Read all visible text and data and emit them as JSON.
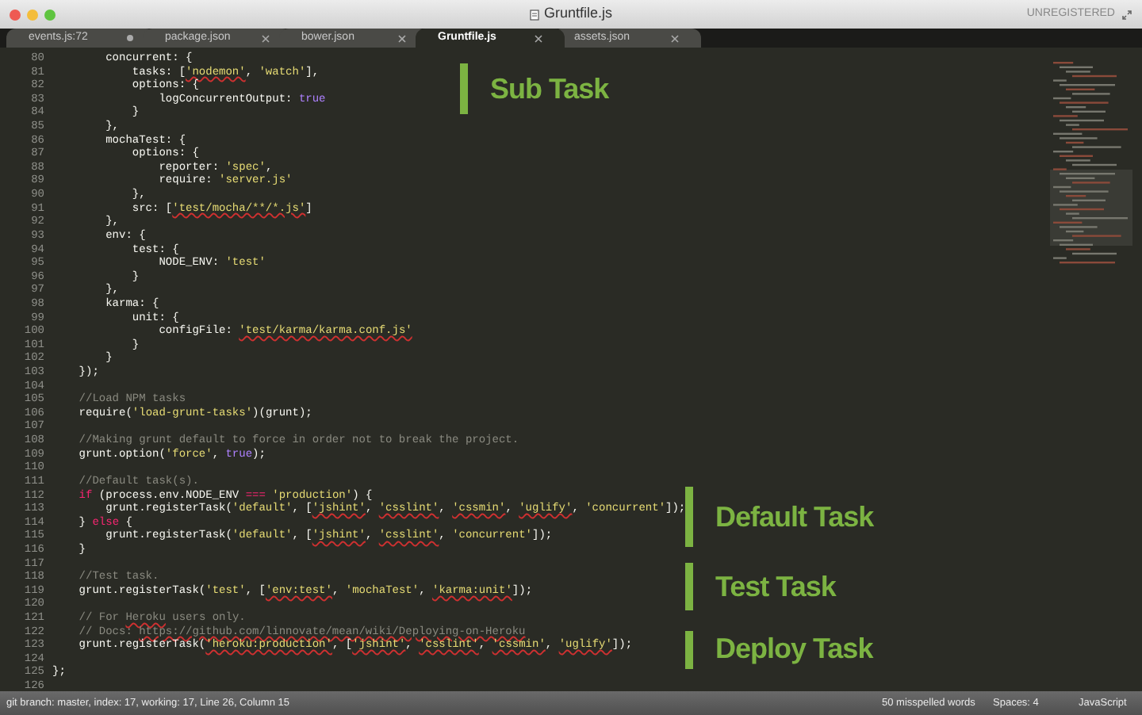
{
  "window": {
    "title": "Gruntfile.js",
    "registration": "UNREGISTERED"
  },
  "tabs": [
    {
      "label": "events.js:72",
      "selected": false,
      "modified": true
    },
    {
      "label": "package.json",
      "selected": false,
      "modified": false
    },
    {
      "label": "bower.json",
      "selected": false,
      "modified": false
    },
    {
      "label": "Gruntfile.js",
      "selected": true,
      "modified": false
    },
    {
      "label": "assets.json",
      "selected": false,
      "modified": false
    }
  ],
  "code": [
    {
      "number": "80",
      "segments": [
        {
          "text": "        concurrent: {",
          "kind": "plain",
          "misspelled": false
        }
      ]
    },
    {
      "number": "81",
      "segments": [
        {
          "text": "            tasks: [",
          "kind": "plain",
          "misspelled": false
        },
        {
          "text": "'nodemon'",
          "kind": "string",
          "misspelled": true
        },
        {
          "text": ", ",
          "kind": "plain",
          "misspelled": false
        },
        {
          "text": "'watch'",
          "kind": "string",
          "misspelled": false
        },
        {
          "text": "],",
          "kind": "plain",
          "misspelled": false
        }
      ]
    },
    {
      "number": "82",
      "segments": [
        {
          "text": "            options: {",
          "kind": "plain",
          "misspelled": false
        }
      ]
    },
    {
      "number": "83",
      "segments": [
        {
          "text": "                logConcurrentOutput: ",
          "kind": "plain",
          "misspelled": false
        },
        {
          "text": "true",
          "kind": "constant",
          "misspelled": false
        }
      ]
    },
    {
      "number": "84",
      "segments": [
        {
          "text": "            }",
          "kind": "plain",
          "misspelled": false
        }
      ]
    },
    {
      "number": "85",
      "segments": [
        {
          "text": "        },",
          "kind": "plain",
          "misspelled": false
        }
      ]
    },
    {
      "number": "86",
      "segments": [
        {
          "text": "        mochaTest: {",
          "kind": "plain",
          "misspelled": false
        }
      ]
    },
    {
      "number": "87",
      "segments": [
        {
          "text": "            options: {",
          "kind": "plain",
          "misspelled": false
        }
      ]
    },
    {
      "number": "88",
      "segments": [
        {
          "text": "                reporter: ",
          "kind": "plain",
          "misspelled": false
        },
        {
          "text": "'spec'",
          "kind": "string",
          "misspelled": false
        },
        {
          "text": ",",
          "kind": "plain",
          "misspelled": false
        }
      ]
    },
    {
      "number": "89",
      "segments": [
        {
          "text": "                require: ",
          "kind": "plain",
          "misspelled": false
        },
        {
          "text": "'server.js'",
          "kind": "string",
          "misspelled": false
        }
      ]
    },
    {
      "number": "90",
      "segments": [
        {
          "text": "            },",
          "kind": "plain",
          "misspelled": false
        }
      ]
    },
    {
      "number": "91",
      "segments": [
        {
          "text": "            src: [",
          "kind": "plain",
          "misspelled": false
        },
        {
          "text": "'test/mocha/**/*.js'",
          "kind": "string",
          "misspelled": true
        },
        {
          "text": "]",
          "kind": "plain",
          "misspelled": false
        }
      ]
    },
    {
      "number": "92",
      "segments": [
        {
          "text": "        },",
          "kind": "plain",
          "misspelled": false
        }
      ]
    },
    {
      "number": "93",
      "segments": [
        {
          "text": "        env: {",
          "kind": "plain",
          "misspelled": false
        }
      ]
    },
    {
      "number": "94",
      "segments": [
        {
          "text": "            test: {",
          "kind": "plain",
          "misspelled": false
        }
      ]
    },
    {
      "number": "95",
      "segments": [
        {
          "text": "                NODE_ENV: ",
          "kind": "plain",
          "misspelled": false
        },
        {
          "text": "'test'",
          "kind": "string",
          "misspelled": false
        }
      ]
    },
    {
      "number": "96",
      "segments": [
        {
          "text": "            }",
          "kind": "plain",
          "misspelled": false
        }
      ]
    },
    {
      "number": "97",
      "segments": [
        {
          "text": "        },",
          "kind": "plain",
          "misspelled": false
        }
      ]
    },
    {
      "number": "98",
      "segments": [
        {
          "text": "        karma: {",
          "kind": "plain",
          "misspelled": false
        }
      ]
    },
    {
      "number": "99",
      "segments": [
        {
          "text": "            unit: {",
          "kind": "plain",
          "misspelled": false
        }
      ]
    },
    {
      "number": "100",
      "segments": [
        {
          "text": "                configFile: ",
          "kind": "plain",
          "misspelled": false
        },
        {
          "text": "'test/karma/karma.conf.js'",
          "kind": "string",
          "misspelled": true
        }
      ]
    },
    {
      "number": "101",
      "segments": [
        {
          "text": "            }",
          "kind": "plain",
          "misspelled": false
        }
      ]
    },
    {
      "number": "102",
      "segments": [
        {
          "text": "        }",
          "kind": "plain",
          "misspelled": false
        }
      ]
    },
    {
      "number": "103",
      "segments": [
        {
          "text": "    });",
          "kind": "plain",
          "misspelled": false
        }
      ]
    },
    {
      "number": "104"
    },
    {
      "number": "105",
      "segments": [
        {
          "text": "    //Load NPM tasks",
          "kind": "comment",
          "misspelled": false
        }
      ]
    },
    {
      "number": "106",
      "segments": [
        {
          "text": "    require(",
          "kind": "plain",
          "misspelled": false
        },
        {
          "text": "'load-grunt-tasks'",
          "kind": "string",
          "misspelled": false
        },
        {
          "text": ")(grunt);",
          "kind": "plain",
          "misspelled": false
        }
      ]
    },
    {
      "number": "107"
    },
    {
      "number": "108",
      "segments": [
        {
          "text": "    //Making grunt default to force in order not to break the project.",
          "kind": "comment",
          "misspelled": false
        }
      ]
    },
    {
      "number": "109",
      "segments": [
        {
          "text": "    grunt.option(",
          "kind": "plain",
          "misspelled": false
        },
        {
          "text": "'force'",
          "kind": "string",
          "misspelled": false
        },
        {
          "text": ", ",
          "kind": "plain",
          "misspelled": false
        },
        {
          "text": "true",
          "kind": "constant",
          "misspelled": false
        },
        {
          "text": ");",
          "kind": "plain",
          "misspelled": false
        }
      ]
    },
    {
      "number": "110"
    },
    {
      "number": "111",
      "segments": [
        {
          "text": "    //Default task(s).",
          "kind": "comment",
          "misspelled": false
        }
      ]
    },
    {
      "number": "112",
      "segments": [
        {
          "text": "    if",
          "kind": "keyword",
          "misspelled": false
        },
        {
          "text": " (process.env.NODE_ENV ",
          "kind": "plain",
          "misspelled": false
        },
        {
          "text": "=== ",
          "kind": "keyword",
          "misspelled": false
        },
        {
          "text": "'production'",
          "kind": "string",
          "misspelled": false
        },
        {
          "text": ") {",
          "kind": "plain",
          "misspelled": false
        }
      ]
    },
    {
      "number": "113",
      "segments": [
        {
          "text": "        grunt.registerTask(",
          "kind": "plain",
          "misspelled": false
        },
        {
          "text": "'default'",
          "kind": "string",
          "misspelled": false
        },
        {
          "text": ", [",
          "kind": "plain",
          "misspelled": false
        },
        {
          "text": "'jshint'",
          "kind": "string",
          "misspelled": true
        },
        {
          "text": ", ",
          "kind": "plain",
          "misspelled": false
        },
        {
          "text": "'csslint'",
          "kind": "string",
          "misspelled": true
        },
        {
          "text": ", ",
          "kind": "plain",
          "misspelled": false
        },
        {
          "text": "'cssmin'",
          "kind": "string",
          "misspelled": true
        },
        {
          "text": ", ",
          "kind": "plain",
          "misspelled": false
        },
        {
          "text": "'uglify'",
          "kind": "string",
          "misspelled": true
        },
        {
          "text": ", ",
          "kind": "plain",
          "misspelled": false
        },
        {
          "text": "'concurrent'",
          "kind": "string",
          "misspelled": false
        },
        {
          "text": "]);",
          "kind": "plain",
          "misspelled": false
        }
      ]
    },
    {
      "number": "114",
      "segments": [
        {
          "text": "    } ",
          "kind": "plain",
          "misspelled": false
        },
        {
          "text": "else",
          "kind": "keyword",
          "misspelled": false
        },
        {
          "text": " {",
          "kind": "plain",
          "misspelled": false
        }
      ]
    },
    {
      "number": "115",
      "segments": [
        {
          "text": "        grunt.registerTask(",
          "kind": "plain",
          "misspelled": false
        },
        {
          "text": "'default'",
          "kind": "string",
          "misspelled": false
        },
        {
          "text": ", [",
          "kind": "plain",
          "misspelled": false
        },
        {
          "text": "'jshint'",
          "kind": "string",
          "misspelled": true
        },
        {
          "text": ", ",
          "kind": "plain",
          "misspelled": false
        },
        {
          "text": "'csslint'",
          "kind": "string",
          "misspelled": true
        },
        {
          "text": ", ",
          "kind": "plain",
          "misspelled": false
        },
        {
          "text": "'concurrent'",
          "kind": "string",
          "misspelled": false
        },
        {
          "text": "]);",
          "kind": "plain",
          "misspelled": false
        }
      ]
    },
    {
      "number": "116",
      "segments": [
        {
          "text": "    }",
          "kind": "plain",
          "misspelled": false
        }
      ]
    },
    {
      "number": "117"
    },
    {
      "number": "118",
      "segments": [
        {
          "text": "    //Test task.",
          "kind": "comment",
          "misspelled": false
        }
      ]
    },
    {
      "number": "119",
      "segments": [
        {
          "text": "    grunt.registerTask(",
          "kind": "plain",
          "misspelled": false
        },
        {
          "text": "'test'",
          "kind": "string",
          "misspelled": false
        },
        {
          "text": ", [",
          "kind": "plain",
          "misspelled": false
        },
        {
          "text": "'env:test'",
          "kind": "string",
          "misspelled": true
        },
        {
          "text": ", ",
          "kind": "plain",
          "misspelled": false
        },
        {
          "text": "'mochaTest'",
          "kind": "string",
          "misspelled": false
        },
        {
          "text": ", ",
          "kind": "plain",
          "misspelled": false
        },
        {
          "text": "'karma:unit'",
          "kind": "string",
          "misspelled": true
        },
        {
          "text": "]);",
          "kind": "plain",
          "misspelled": false
        }
      ]
    },
    {
      "number": "120"
    },
    {
      "number": "121",
      "segments": [
        {
          "text": "    // For ",
          "kind": "comment",
          "misspelled": false
        },
        {
          "text": "Heroku",
          "kind": "comment",
          "misspelled": true
        },
        {
          "text": " users only.",
          "kind": "comment",
          "misspelled": false
        }
      ]
    },
    {
      "number": "122",
      "segments": [
        {
          "text": "    // Docs: ",
          "kind": "comment",
          "misspelled": false
        },
        {
          "text": "https://github.com/linnovate/mean/wiki/Deploying-on-Heroku",
          "kind": "comment",
          "misspelled": true
        }
      ]
    },
    {
      "number": "123",
      "segments": [
        {
          "text": "    grunt.registerTask(",
          "kind": "plain",
          "misspelled": false
        },
        {
          "text": "'heroku:production'",
          "kind": "string",
          "misspelled": true
        },
        {
          "text": ", [",
          "kind": "plain",
          "misspelled": false
        },
        {
          "text": "'jshint'",
          "kind": "string",
          "misspelled": true
        },
        {
          "text": ", ",
          "kind": "plain",
          "misspelled": false
        },
        {
          "text": "'csslint'",
          "kind": "string",
          "misspelled": true
        },
        {
          "text": ", ",
          "kind": "plain",
          "misspelled": false
        },
        {
          "text": "'cssmin'",
          "kind": "string",
          "misspelled": true
        },
        {
          "text": ", ",
          "kind": "plain",
          "misspelled": false
        },
        {
          "text": "'uglify'",
          "kind": "string",
          "misspelled": true
        },
        {
          "text": "]);",
          "kind": "plain",
          "misspelled": false
        }
      ]
    },
    {
      "number": "124"
    },
    {
      "number": "125",
      "segments": [
        {
          "text": "};",
          "kind": "plain",
          "misspelled": false
        }
      ]
    },
    {
      "number": "126"
    }
  ],
  "annotations": [
    {
      "label": "Sub Task"
    },
    {
      "label": "Default Task"
    },
    {
      "label": "Test Task"
    },
    {
      "label": "Deploy Task"
    }
  ],
  "status_bar": {
    "git": "git branch: master, index: 17, working: 17, Line 26, Column 15",
    "spelling": "50 misspelled words",
    "indentation": "Spaces: 4",
    "syntax": "JavaScript"
  }
}
